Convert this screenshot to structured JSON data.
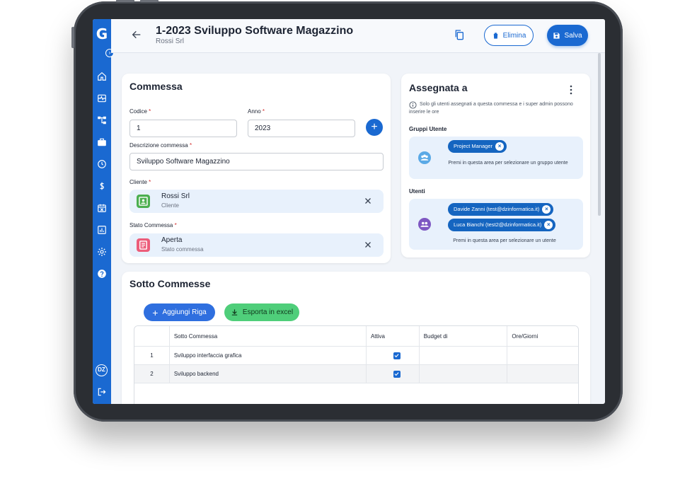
{
  "header": {
    "title": "1-2023 Sviluppo Software Magazzino",
    "subtitle": "Rossi Srl",
    "delete_label": "Elimina",
    "save_label": "Salva"
  },
  "sidebar": {
    "logo": "G",
    "toggle": "›",
    "avatar_initials": "DZ",
    "icons": [
      "home-icon",
      "dashboard-icon",
      "hierarchy-icon",
      "briefcase-icon",
      "clock-icon",
      "dollar-icon",
      "calendar-icon",
      "report-icon",
      "gear-icon",
      "help-icon"
    ]
  },
  "commessa": {
    "title": "Commessa",
    "codice_label": "Codice",
    "codice_value": "1",
    "anno_label": "Anno",
    "anno_value": "2023",
    "descrizione_label": "Descrizione commessa",
    "descrizione_value": "Sviluppo Software Magazzino",
    "cliente_label": "Cliente",
    "cliente_value": "Rossi Srl",
    "cliente_sub": "Cliente",
    "stato_label": "Stato Commessa",
    "stato_value": "Aperta",
    "stato_sub": "Stato commessa",
    "required_mark": "*"
  },
  "assegnata": {
    "title": "Assegnata a",
    "info": "Solo gli utenti assegnati a questa commessa e i super admin possono inserire le ore",
    "gruppi_label": "Gruppi Utente",
    "gruppi_chips": [
      "Project Manager"
    ],
    "gruppi_hint": "Premi in questa area per selezionare un gruppo utente",
    "utenti_label": "Utenti",
    "utenti_chips": [
      "Davide Zanni (test@dzinformatica.it)",
      "Luca Bianchi (test2@dzinformatica.it)"
    ],
    "utenti_hint": "Premi in questa area per selezionare un utente"
  },
  "sotto": {
    "title": "Sotto Commesse",
    "add_label": "Aggiungi Riga",
    "export_label": "Esporta in excel",
    "columns": [
      "",
      "Sotto Commessa",
      "Attiva",
      "Budget di",
      "Ore/Giorni"
    ],
    "rows": [
      {
        "n": "1",
        "name": "Sviluppo interfaccia grafica",
        "active": true,
        "budget": "",
        "ore": ""
      },
      {
        "n": "2",
        "name": "Sviluppo backend",
        "active": true,
        "budget": "",
        "ore": ""
      }
    ]
  },
  "colors": {
    "primary": "#1a69d1",
    "success": "#4fce7a",
    "chip": "#1565c0"
  }
}
